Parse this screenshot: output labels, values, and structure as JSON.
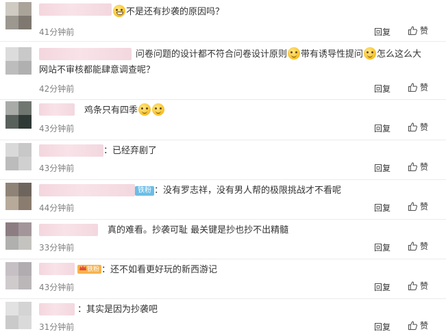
{
  "comments": [
    {
      "text_parts": [
        "不是还有抄袭的原因吗？"
      ],
      "time": "41分钟前",
      "reply": "回复",
      "like": "赞"
    },
    {
      "text_parts": [
        "问卷问题的设计都不符合问卷设计原则",
        "带有诱导性提问",
        "怎么这么大",
        "网站不审核都能肆意调查呢？"
      ],
      "time": "42分钟前",
      "reply": "回复",
      "like": "赞"
    },
    {
      "text_parts": [
        "鸡条只有四季"
      ],
      "time": "43分钟前",
      "reply": "回复",
      "like": "赞"
    },
    {
      "text_parts": [
        "：已经弃剧了"
      ],
      "time": "43分钟前",
      "reply": "回复",
      "like": "赞"
    },
    {
      "badge": "铁粉",
      "text_parts": [
        "：没有罗志祥，没有男人帮的极限挑战才不看呢"
      ],
      "time": "44分钟前",
      "reply": "回复",
      "like": "赞"
    },
    {
      "text_parts": [
        "真的难看。抄袭可耻 最关键是抄也抄不出精髓"
      ],
      "time": "33分钟前",
      "reply": "回复",
      "like": "赞"
    },
    {
      "badge": "铁粉",
      "text_parts": [
        "：还不如看更好玩的新西游记"
      ],
      "time": "43分钟前",
      "reply": "回复",
      "like": "赞"
    },
    {
      "text_parts": [
        "：其实是因为抄袭吧"
      ],
      "time": "31分钟前",
      "reply": "回复",
      "like": "赞"
    }
  ],
  "icons": {
    "emoji": "smile-emoji-icon",
    "grin": "grin-emoji-icon",
    "like": "thumbs-up-icon",
    "crown": "crown-icon"
  },
  "colors": {
    "time": "#808080",
    "badge_fan": "#6bbde6",
    "badge_gold": "#f6b34d",
    "divider": "#ebebeb"
  }
}
